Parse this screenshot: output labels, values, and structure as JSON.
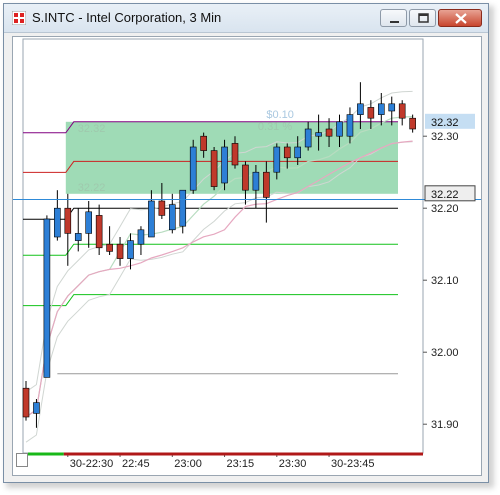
{
  "window": {
    "title": "S.INTC - Intel Corporation, 3 Min"
  },
  "icons": {
    "app": "app-icon",
    "minimize": "minimize-icon",
    "maximize": "maximize-icon",
    "close": "close-icon"
  },
  "colors": {
    "up": "#2d7fd6",
    "down": "#c0392b",
    "zone_fill": "#7fcf9e",
    "zone_text": "#9fc9ad",
    "bollinger": "#d0d6d2",
    "ma_fast": "#b8dcc0",
    "ma_slow": "#e6a8c0",
    "current_price": "#2e8ad8",
    "purple_level": "#800080",
    "red_level": "#cc2222",
    "black_level": "#000000",
    "green_level": "#12c21a",
    "grey_level": "#999999",
    "last_price_box": "#c5def3"
  },
  "chart_data": {
    "type": "candlestick",
    "y_range": [
      31.86,
      32.435
    ],
    "y_ticks": [
      "32.30",
      "32.20",
      "32.10",
      "32.00",
      "31.90"
    ],
    "x_ticks": [
      "30-22:30",
      "22:45",
      "23:00",
      "23:15",
      "23:30",
      "30-23:45"
    ],
    "candles": [
      {
        "o": 31.95,
        "h": 31.96,
        "l": 31.905,
        "c": 31.91
      },
      {
        "o": 31.915,
        "h": 31.935,
        "l": 31.895,
        "c": 31.93
      },
      {
        "o": 31.965,
        "h": 32.19,
        "l": 31.965,
        "c": 32.185
      },
      {
        "o": 32.16,
        "h": 32.225,
        "l": 32.155,
        "c": 32.2
      },
      {
        "o": 32.2,
        "h": 32.22,
        "l": 32.12,
        "c": 32.165
      },
      {
        "o": 32.155,
        "h": 32.2,
        "l": 32.14,
        "c": 32.165
      },
      {
        "o": 32.165,
        "h": 32.21,
        "l": 32.145,
        "c": 32.195
      },
      {
        "o": 32.19,
        "h": 32.205,
        "l": 32.135,
        "c": 32.145
      },
      {
        "o": 32.15,
        "h": 32.175,
        "l": 32.135,
        "c": 32.14
      },
      {
        "o": 32.15,
        "h": 32.16,
        "l": 32.12,
        "c": 32.13
      },
      {
        "o": 32.13,
        "h": 32.165,
        "l": 32.115,
        "c": 32.155
      },
      {
        "o": 32.15,
        "h": 32.175,
        "l": 32.135,
        "c": 32.17
      },
      {
        "o": 32.16,
        "h": 32.225,
        "l": 32.16,
        "c": 32.21
      },
      {
        "o": 32.21,
        "h": 32.235,
        "l": 32.185,
        "c": 32.19
      },
      {
        "o": 32.17,
        "h": 32.22,
        "l": 32.165,
        "c": 32.205
      },
      {
        "o": 32.175,
        "h": 32.22,
        "l": 32.165,
        "c": 32.225
      },
      {
        "o": 32.225,
        "h": 32.295,
        "l": 32.22,
        "c": 32.285
      },
      {
        "o": 32.3,
        "h": 32.305,
        "l": 32.27,
        "c": 32.28
      },
      {
        "o": 32.28,
        "h": 32.285,
        "l": 32.225,
        "c": 32.23
      },
      {
        "o": 32.235,
        "h": 32.295,
        "l": 32.225,
        "c": 32.285
      },
      {
        "o": 32.29,
        "h": 32.3,
        "l": 32.255,
        "c": 32.26
      },
      {
        "o": 32.26,
        "h": 32.265,
        "l": 32.205,
        "c": 32.225
      },
      {
        "o": 32.225,
        "h": 32.26,
        "l": 32.2,
        "c": 32.25
      },
      {
        "o": 32.25,
        "h": 32.265,
        "l": 32.18,
        "c": 32.215
      },
      {
        "o": 32.25,
        "h": 32.29,
        "l": 32.24,
        "c": 32.285
      },
      {
        "o": 32.285,
        "h": 32.29,
        "l": 32.255,
        "c": 32.27
      },
      {
        "o": 32.27,
        "h": 32.3,
        "l": 32.26,
        "c": 32.285
      },
      {
        "o": 32.285,
        "h": 32.32,
        "l": 32.28,
        "c": 32.31
      },
      {
        "o": 32.3,
        "h": 32.33,
        "l": 32.28,
        "c": 32.305
      },
      {
        "o": 32.31,
        "h": 32.325,
        "l": 32.285,
        "c": 32.3
      },
      {
        "o": 32.3,
        "h": 32.33,
        "l": 32.285,
        "c": 32.32
      },
      {
        "o": 32.3,
        "h": 32.34,
        "l": 32.29,
        "c": 32.33
      },
      {
        "o": 32.33,
        "h": 32.375,
        "l": 32.31,
        "c": 32.345
      },
      {
        "o": 32.34,
        "h": 32.35,
        "l": 32.31,
        "c": 32.325
      },
      {
        "o": 32.33,
        "h": 32.36,
        "l": 32.315,
        "c": 32.345
      },
      {
        "o": 32.335,
        "h": 32.355,
        "l": 32.315,
        "c": 32.345
      },
      {
        "o": 32.345,
        "h": 32.35,
        "l": 32.315,
        "c": 32.325
      },
      {
        "o": 32.325,
        "h": 32.33,
        "l": 32.305,
        "c": 32.31
      }
    ],
    "zone": {
      "top": 32.32,
      "bottom": 32.22,
      "label_top": "32.32",
      "label_bottom": "32.22",
      "label_mid": "$0.10",
      "label_pct": "0.31 %"
    },
    "levels": [
      {
        "price": 32.32,
        "color": "#800080",
        "kind": "step"
      },
      {
        "price": 32.265,
        "color": "#cc2222",
        "kind": "step"
      },
      {
        "price": 32.2,
        "color": "#000000",
        "kind": "step"
      },
      {
        "price": 32.15,
        "color": "#12c21a",
        "kind": "step"
      },
      {
        "price": 32.08,
        "color": "#12c21a",
        "kind": "step"
      },
      {
        "price": 31.97,
        "color": "#999999",
        "kind": "flat"
      }
    ],
    "current_price": 32.212,
    "price_marks": [
      {
        "price": 32.32,
        "label": "32.32",
        "style": "highlight"
      },
      {
        "price": 32.22,
        "label": "32.22",
        "style": "box"
      }
    ]
  }
}
